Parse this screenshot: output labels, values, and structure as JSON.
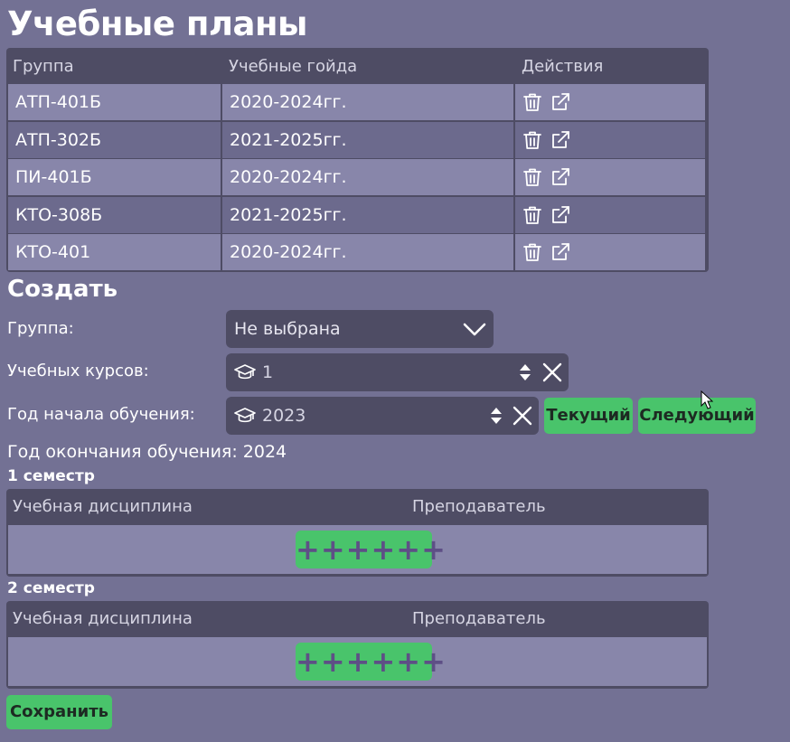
{
  "page": {
    "title": "Учебные планы"
  },
  "plans_table": {
    "headers": [
      "Группа",
      "Учебные гойда",
      "Действия"
    ],
    "rows": [
      {
        "group": "АТП-401Б",
        "years": "2020-2024гг."
      },
      {
        "group": "АТП-302Б",
        "years": "2021-2025гг."
      },
      {
        "group": "ПИ-401Б",
        "years": "2020-2024гг."
      },
      {
        "group": "КТО-308Б",
        "years": "2021-2025гг."
      },
      {
        "group": "КТО-401",
        "years": "2020-2024гг."
      }
    ]
  },
  "create": {
    "title": "Создать",
    "group_label": "Группа:",
    "group_value": "Не выбрана",
    "courses_label": "Учебных курсов:",
    "courses_value": "1",
    "start_label": "Год начала обучения:",
    "start_value": "2023",
    "current_button": "Текущий",
    "next_button": "Следующий",
    "end_text": "Год окончания обучения: 2024"
  },
  "semesters": [
    {
      "title": "1 семестр",
      "col_discipline": "Учебная дисциплина",
      "col_teacher": "Преподаватель",
      "add_label": "++++++"
    },
    {
      "title": "2 семестр",
      "col_discipline": "Учебная дисциплина",
      "col_teacher": "Преподаватель",
      "add_label": "++++++"
    }
  ],
  "save_button": "Сохранить",
  "colors": {
    "background": "#737194",
    "header": "#4e4c64",
    "row_light": "#8886aa",
    "row_dark": "#6c6a8d",
    "accent": "#49c46b"
  },
  "icons": [
    "trash-icon",
    "external-link-icon",
    "chevron-down-icon",
    "graduation-cap-icon",
    "spinner-arrows-icon",
    "clear-icon",
    "mouse-cursor-icon"
  ]
}
